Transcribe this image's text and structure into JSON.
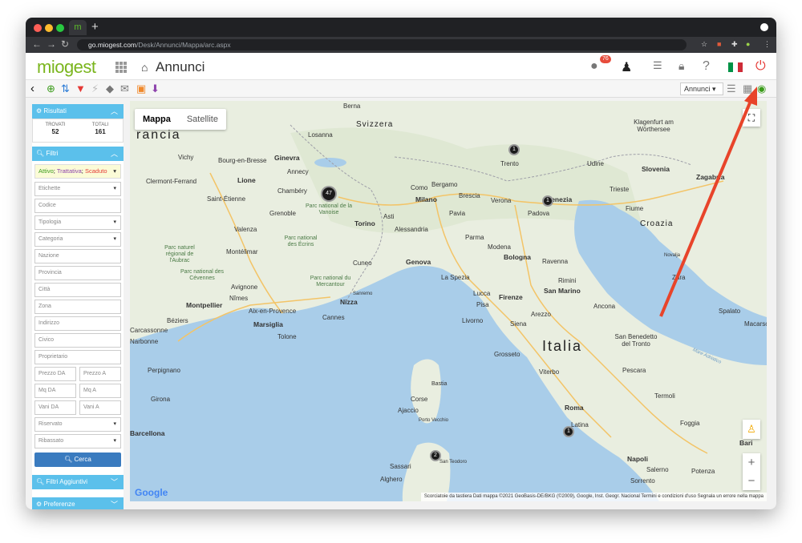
{
  "browser": {
    "tab_favicon": "m",
    "url_host": "go.miogest.com",
    "url_path": "/Desk/Annunci/Mappa/arc.aspx"
  },
  "app": {
    "logo": "miogest",
    "title": "Annunci",
    "notification_count": "76"
  },
  "toolbar": {
    "view_select": "Annunci"
  },
  "sidebar": {
    "results": {
      "title": "Risultati",
      "found_label": "TROVATI",
      "found_value": "52",
      "total_label": "TOTALI",
      "total_value": "161"
    },
    "filters": {
      "title": "Filtri",
      "status": [
        "Attivo",
        "Trattativa",
        "Scaduto"
      ],
      "status_colors": [
        "#3a9b1a",
        "#8e44ad",
        "#e53935"
      ],
      "fields": [
        "Etichette",
        "Codice",
        "Tipologia",
        "Categoria",
        "Nazione",
        "Provincia",
        "Città",
        "Zona",
        "Indirizzo",
        "Civico",
        "Proprietario"
      ],
      "price_from": "Prezzo DA",
      "price_to": "Prezzo A",
      "sqm_from": "Mq DA",
      "sqm_to": "Mq A",
      "rooms_from": "Vani DA",
      "rooms_to": "Vani A",
      "reserved": "Riservato",
      "discounted": "Ribassato",
      "search_button": "Cerca"
    },
    "extra_filters": "Filtri Aggiuntivi",
    "preferences": "Preferenze"
  },
  "map": {
    "tab_map": "Mappa",
    "tab_satellite": "Satellite",
    "google": "Google",
    "attribution": "Scorciatoie da tastiera   Dati mappa ©2021 GeoBasis-DE/BKG (©2009), Google, Inst. Geogr. Nacional   Termini e condizioni d'uso   Segnala un errore nella mappa",
    "countries": {
      "italia": "Italia",
      "francia": "rancia",
      "svizzera": "Svizzera",
      "croazia": "Croazia",
      "slovenia": "Slovenia"
    },
    "cities": [
      "Berna",
      "Losanna",
      "Ginevra",
      "Annecy",
      "Chambéry",
      "Lione",
      "Grenoble",
      "Valenza",
      "Montélimar",
      "Avignone",
      "Nîmes",
      "Montpellier",
      "Aix-en-Provence",
      "Marsiglia",
      "Tolone",
      "Cannes",
      "Nizza",
      "Sanremo",
      "Torino",
      "Cuneo",
      "Genova",
      "Milano",
      "Bergamo",
      "Brescia",
      "Como",
      "Verona",
      "Venezia",
      "Padova",
      "Trento",
      "Udine",
      "Trieste",
      "Fiume",
      "Parma",
      "Modena",
      "Bologna",
      "Ravenna",
      "Rimini",
      "San Marino",
      "La Spezia",
      "Lucca",
      "Pisa",
      "Firenze",
      "Livorno",
      "Siena",
      "Arezzo",
      "Grosseto",
      "Viterbo",
      "Roma",
      "Latina",
      "Ancona",
      "Pescara",
      "Termoli",
      "Foggia",
      "Bari",
      "Napoli",
      "Salerno",
      "Potenza",
      "Sorrento",
      "Sassari",
      "Alghero",
      "Corse",
      "Ajaccio",
      "Porto Vecchio",
      "Bastia",
      "Narbonne",
      "Perpignano",
      "Girona",
      "Béziers",
      "Clermont-Ferrand",
      "Saint-Étienne",
      "Bourg-en-Bresse",
      "Vichy",
      "Zagabria",
      "Klagenfurt am Wörthersee",
      "Spalato",
      "Zara",
      "Pavia",
      "Alessandria",
      "Asti",
      "San Teodoro",
      "Macarsca",
      "Novalja",
      "San Benedetto del Tronto",
      "Carcassonne",
      "Barcellona"
    ],
    "parks": [
      "Parc national de la Vanoise",
      "Parc national des Écrins",
      "Parc naturel régional de l'Aubrac",
      "Parc national des Cévennes",
      "Parc national du Mercantour"
    ],
    "sea": "Mare Adriatico",
    "clusters": [
      "1",
      "47",
      "1",
      "1",
      "2"
    ]
  }
}
